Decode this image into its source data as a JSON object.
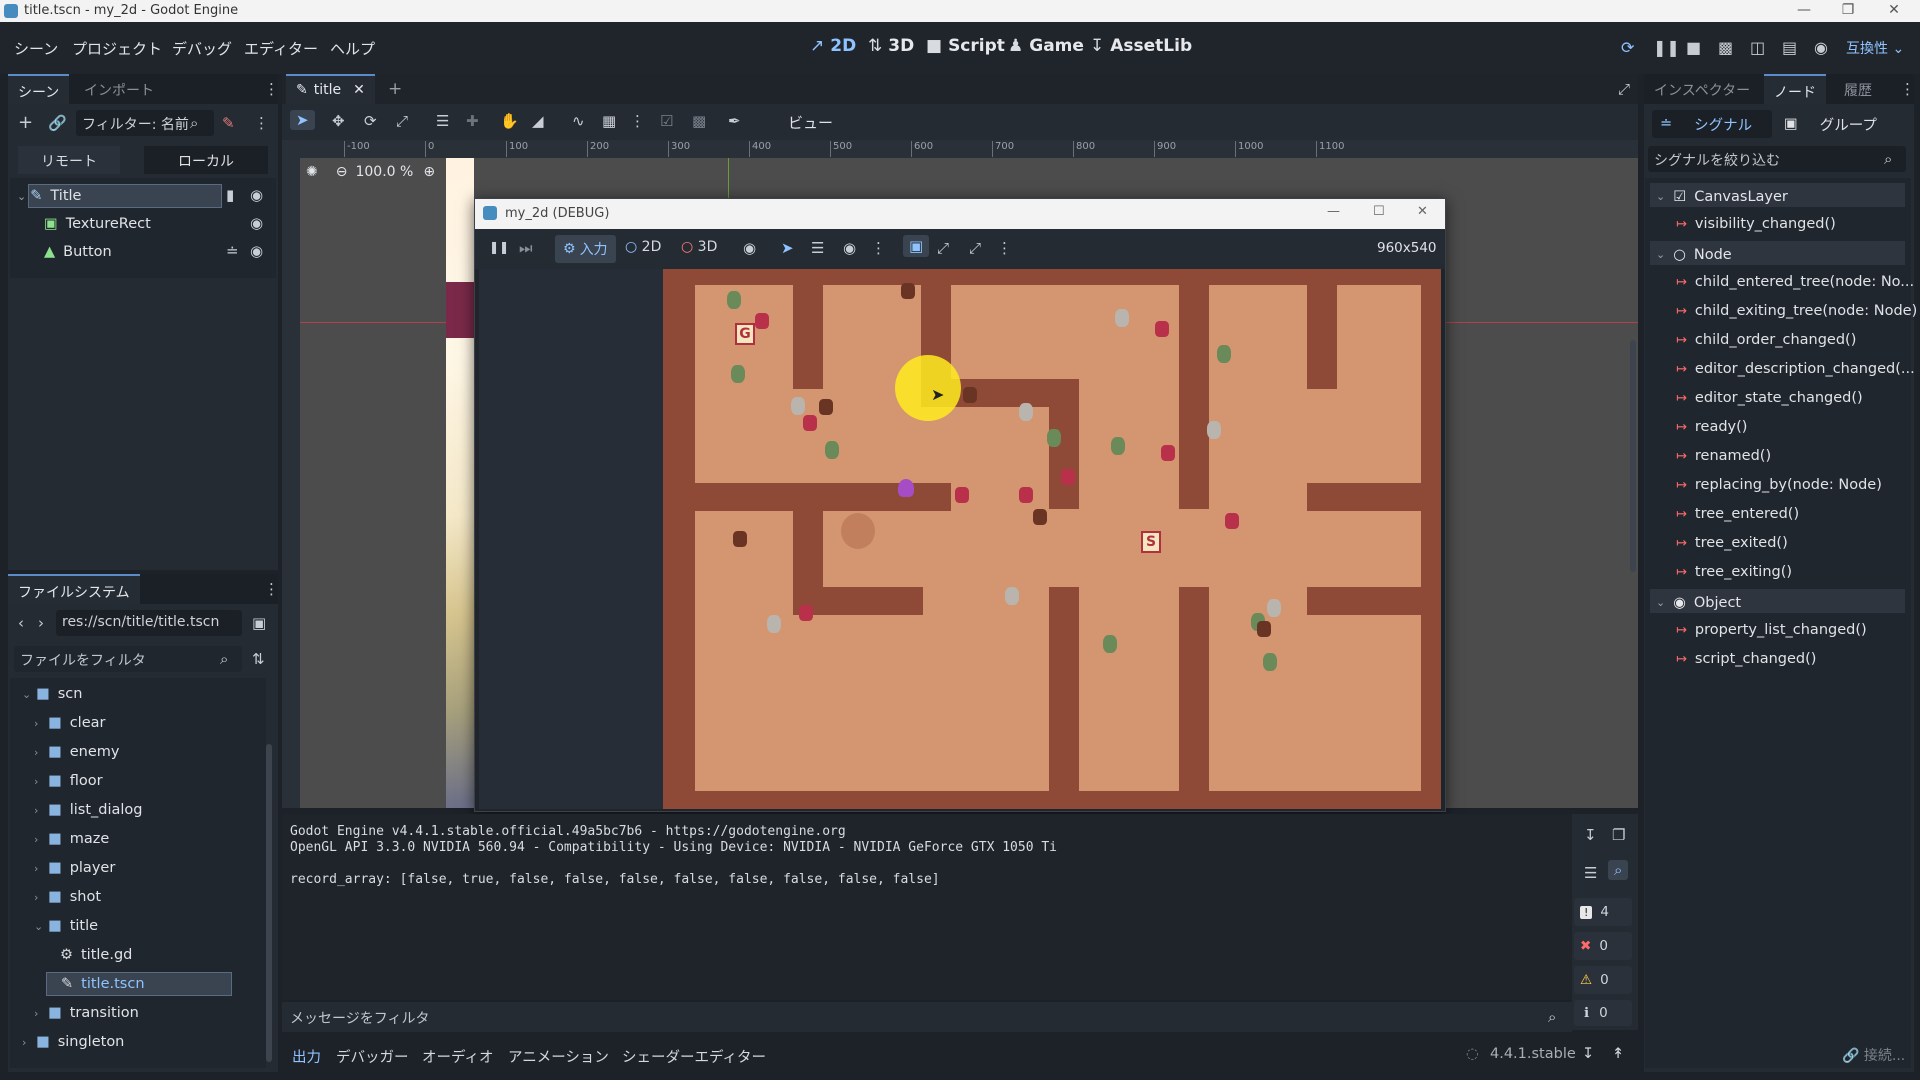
{
  "window": {
    "title": "title.tscn - my_2d - Godot Engine",
    "minimize_icon": "minimize-icon",
    "maximize_icon": "maximize-icon",
    "close_icon": "close-icon"
  },
  "menu": {
    "items": [
      "シーン",
      "プロジェクト",
      "デバッグ",
      "エディター",
      "ヘルプ"
    ]
  },
  "workspaces": {
    "items": [
      {
        "label": "2D",
        "icon": "2d-icon"
      },
      {
        "label": "3D",
        "icon": "3d-icon"
      },
      {
        "label": "Script",
        "icon": "script-icon"
      },
      {
        "label": "Game",
        "icon": "game-icon"
      },
      {
        "label": "AssetLib",
        "icon": "assetlib-icon"
      }
    ],
    "active": "2D",
    "renderer": "互換性"
  },
  "scene_dock": {
    "tabs": [
      "シーン",
      "インポート"
    ],
    "filter_placeholder": "フィルター: 名前",
    "remote_label": "リモート",
    "local_label": "ローカル",
    "nodes": [
      {
        "name": "Title",
        "icon": "canvaslayer-icon"
      },
      {
        "name": "TextureRect",
        "icon": "texturerect-icon"
      },
      {
        "name": "Button",
        "icon": "button-icon"
      }
    ]
  },
  "filesystem": {
    "tab": "ファイルシステム",
    "path": "res://scn/title/title.tscn",
    "filter_placeholder": "ファイルをフィルタ",
    "items": [
      {
        "label": "scn",
        "type": "folder",
        "level": 0,
        "open": true
      },
      {
        "label": "clear",
        "type": "folder",
        "level": 1
      },
      {
        "label": "enemy",
        "type": "folder",
        "level": 1
      },
      {
        "label": "floor",
        "type": "folder",
        "level": 1
      },
      {
        "label": "list_dialog",
        "type": "folder",
        "level": 1
      },
      {
        "label": "maze",
        "type": "folder",
        "level": 1
      },
      {
        "label": "player",
        "type": "folder",
        "level": 1
      },
      {
        "label": "shot",
        "type": "folder",
        "level": 1
      },
      {
        "label": "title",
        "type": "folder",
        "level": 1,
        "open": true
      },
      {
        "label": "title.gd",
        "type": "script",
        "level": 2
      },
      {
        "label": "title.tscn",
        "type": "scene",
        "level": 2,
        "selected": true
      },
      {
        "label": "transition",
        "type": "folder",
        "level": 1
      },
      {
        "label": "singleton",
        "type": "folder",
        "level": 0
      }
    ]
  },
  "editor": {
    "tab_label": "title",
    "view_label": "ビュー",
    "zoom": "100.0 %",
    "ruler_ticks": [
      "-100",
      "0",
      "100",
      "200",
      "300",
      "400",
      "500",
      "600",
      "700",
      "800",
      "900",
      "1000",
      "1100"
    ]
  },
  "game_window": {
    "title": "my_2d (DEBUG)",
    "input_label": "入力",
    "mode_2d": "2D",
    "mode_3d": "3D",
    "resolution": "960x540"
  },
  "output": {
    "lines": [
      "Godot Engine v4.4.1.stable.official.49a5bc7b6 - https://godotengine.org",
      "OpenGL API 3.3.0 NVIDIA 560.94 - Compatibility - Using Device: NVIDIA - NVIDIA GeForce GTX 1050 Ti",
      "",
      "record_array: [false, true, false, false, false, false, false, false, false, false]"
    ],
    "filter_placeholder": "メッセージをフィルタ",
    "counts": {
      "messages": "4",
      "errors": "0",
      "warnings": "0",
      "info": "0"
    }
  },
  "bottom_tabs": [
    "出力",
    "デバッガー",
    "オーディオ",
    "アニメーション",
    "シェーダーエディター"
  ],
  "version": "4.4.1.stable",
  "inspector": {
    "tabs": [
      "インスペクター",
      "ノード",
      "履歴"
    ],
    "subtabs": [
      "シグナル",
      "グループ"
    ],
    "filter_placeholder": "シグナルを絞り込む",
    "groups": [
      {
        "name": "CanvasLayer",
        "signals": [
          "visibility_changed()"
        ]
      },
      {
        "name": "Node",
        "signals": [
          "child_entered_tree(node: No...",
          "child_exiting_tree(node: Node)",
          "child_order_changed()",
          "editor_description_changed(...",
          "editor_state_changed()",
          "ready()",
          "renamed()",
          "replacing_by(node: Node)",
          "tree_entered()",
          "tree_exited()",
          "tree_exiting()"
        ]
      },
      {
        "name": "Object",
        "signals": [
          "property_list_changed()",
          "script_changed()"
        ]
      }
    ],
    "connect_label": "接続..."
  }
}
